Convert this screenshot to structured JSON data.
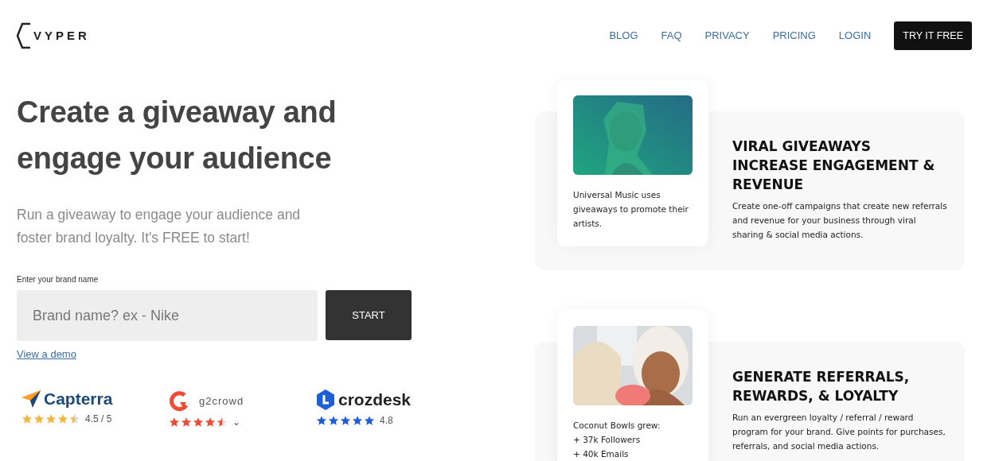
{
  "header": {
    "logo": "VYPER",
    "nav": [
      {
        "label": "BLOG",
        "kind": "link"
      },
      {
        "label": "FAQ",
        "kind": "link"
      },
      {
        "label": "PRIVACY",
        "kind": "link"
      },
      {
        "label": "PRICING",
        "kind": "link"
      },
      {
        "label": "LOGIN",
        "kind": "link"
      },
      {
        "label": "TRY IT FREE",
        "kind": "button"
      }
    ]
  },
  "hero": {
    "title": "Create a giveaway and engage your audience",
    "subtitle": "Run a giveaway to engage your audience and foster brand loyalty. It's FREE to start!",
    "field_label": "Enter your brand name",
    "placeholder": "Brand name? ex - Nike",
    "button": "START",
    "demo_link": "View a demo"
  },
  "ratings": [
    {
      "kind": "capterra",
      "name": "Capterra",
      "stars": 4.5,
      "color": "#f4b63f",
      "score": "4.5 / 5"
    },
    {
      "kind": "g2",
      "name": "g2crowd",
      "stars": 4.5,
      "color": "#ef4a33",
      "score": "⌄"
    },
    {
      "kind": "crozdesk",
      "name": "crozdesk",
      "stars": 5,
      "color": "#1e5fd6",
      "score": "4.8"
    }
  ],
  "features": [
    {
      "picture": {
        "kind": "picture"
      },
      "caption": [
        "Universal Music uses giveaways to promote their artists."
      ],
      "title": "VIRAL GIVEAWAYS INCREASE ENGAGEMENT & REVENUE",
      "text": "Create one-off campaigns that create new referrals and revenue for your business through viral sharing & social media actions."
    },
    {
      "picture": {
        "kind": "picture"
      },
      "caption": [
        "Coconut Bowls grew:",
        "+ 37k Followers",
        "+ 40k Emails"
      ],
      "title": "GENERATE REFERRALS, REWARDS, & LOYALTY",
      "text": "Run an evergreen loyalty / referral / reward program for your brand. Give points for purchases, referrals, and social media actions."
    }
  ]
}
